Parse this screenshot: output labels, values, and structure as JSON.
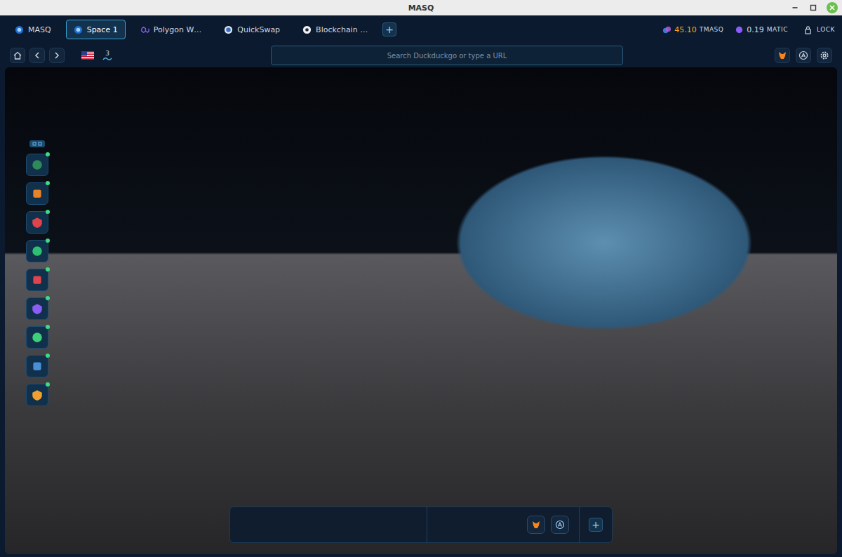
{
  "window": {
    "title": "MASQ"
  },
  "tabs": [
    {
      "label": "MASQ",
      "selected": false
    },
    {
      "label": "Space 1",
      "selected": true
    },
    {
      "label": "Polygon W…",
      "selected": false
    },
    {
      "label": "QuickSwap",
      "selected": false
    },
    {
      "label": "Blockchain …",
      "selected": false
    }
  ],
  "new_tab_button": "+",
  "balances": [
    {
      "amount": "45.10",
      "unit": "TMASQ",
      "color": "#f5a623"
    },
    {
      "amount": "0.19",
      "unit": "MATIC",
      "color": "#d6dde6"
    }
  ],
  "lock_button": "LOCK",
  "toolbar": {
    "badge": "3"
  },
  "search": {
    "placeholder": "Search Duckduckgo or type a URL"
  },
  "sidebar": {
    "items": [
      {
        "online": true,
        "color": "#2f8a5a"
      },
      {
        "online": true,
        "color": "#e8832a"
      },
      {
        "online": true,
        "color": "#e0434b"
      },
      {
        "online": true,
        "color": "#2fbf71"
      },
      {
        "online": true,
        "color": "#e0434b"
      },
      {
        "online": true,
        "color": "#8b5cf6"
      },
      {
        "online": true,
        "color": "#3fcf7a"
      },
      {
        "online": true,
        "color": "#4a90d9"
      },
      {
        "online": true,
        "color": "#f0a030"
      }
    ]
  },
  "dock": {
    "add_button": "+"
  }
}
